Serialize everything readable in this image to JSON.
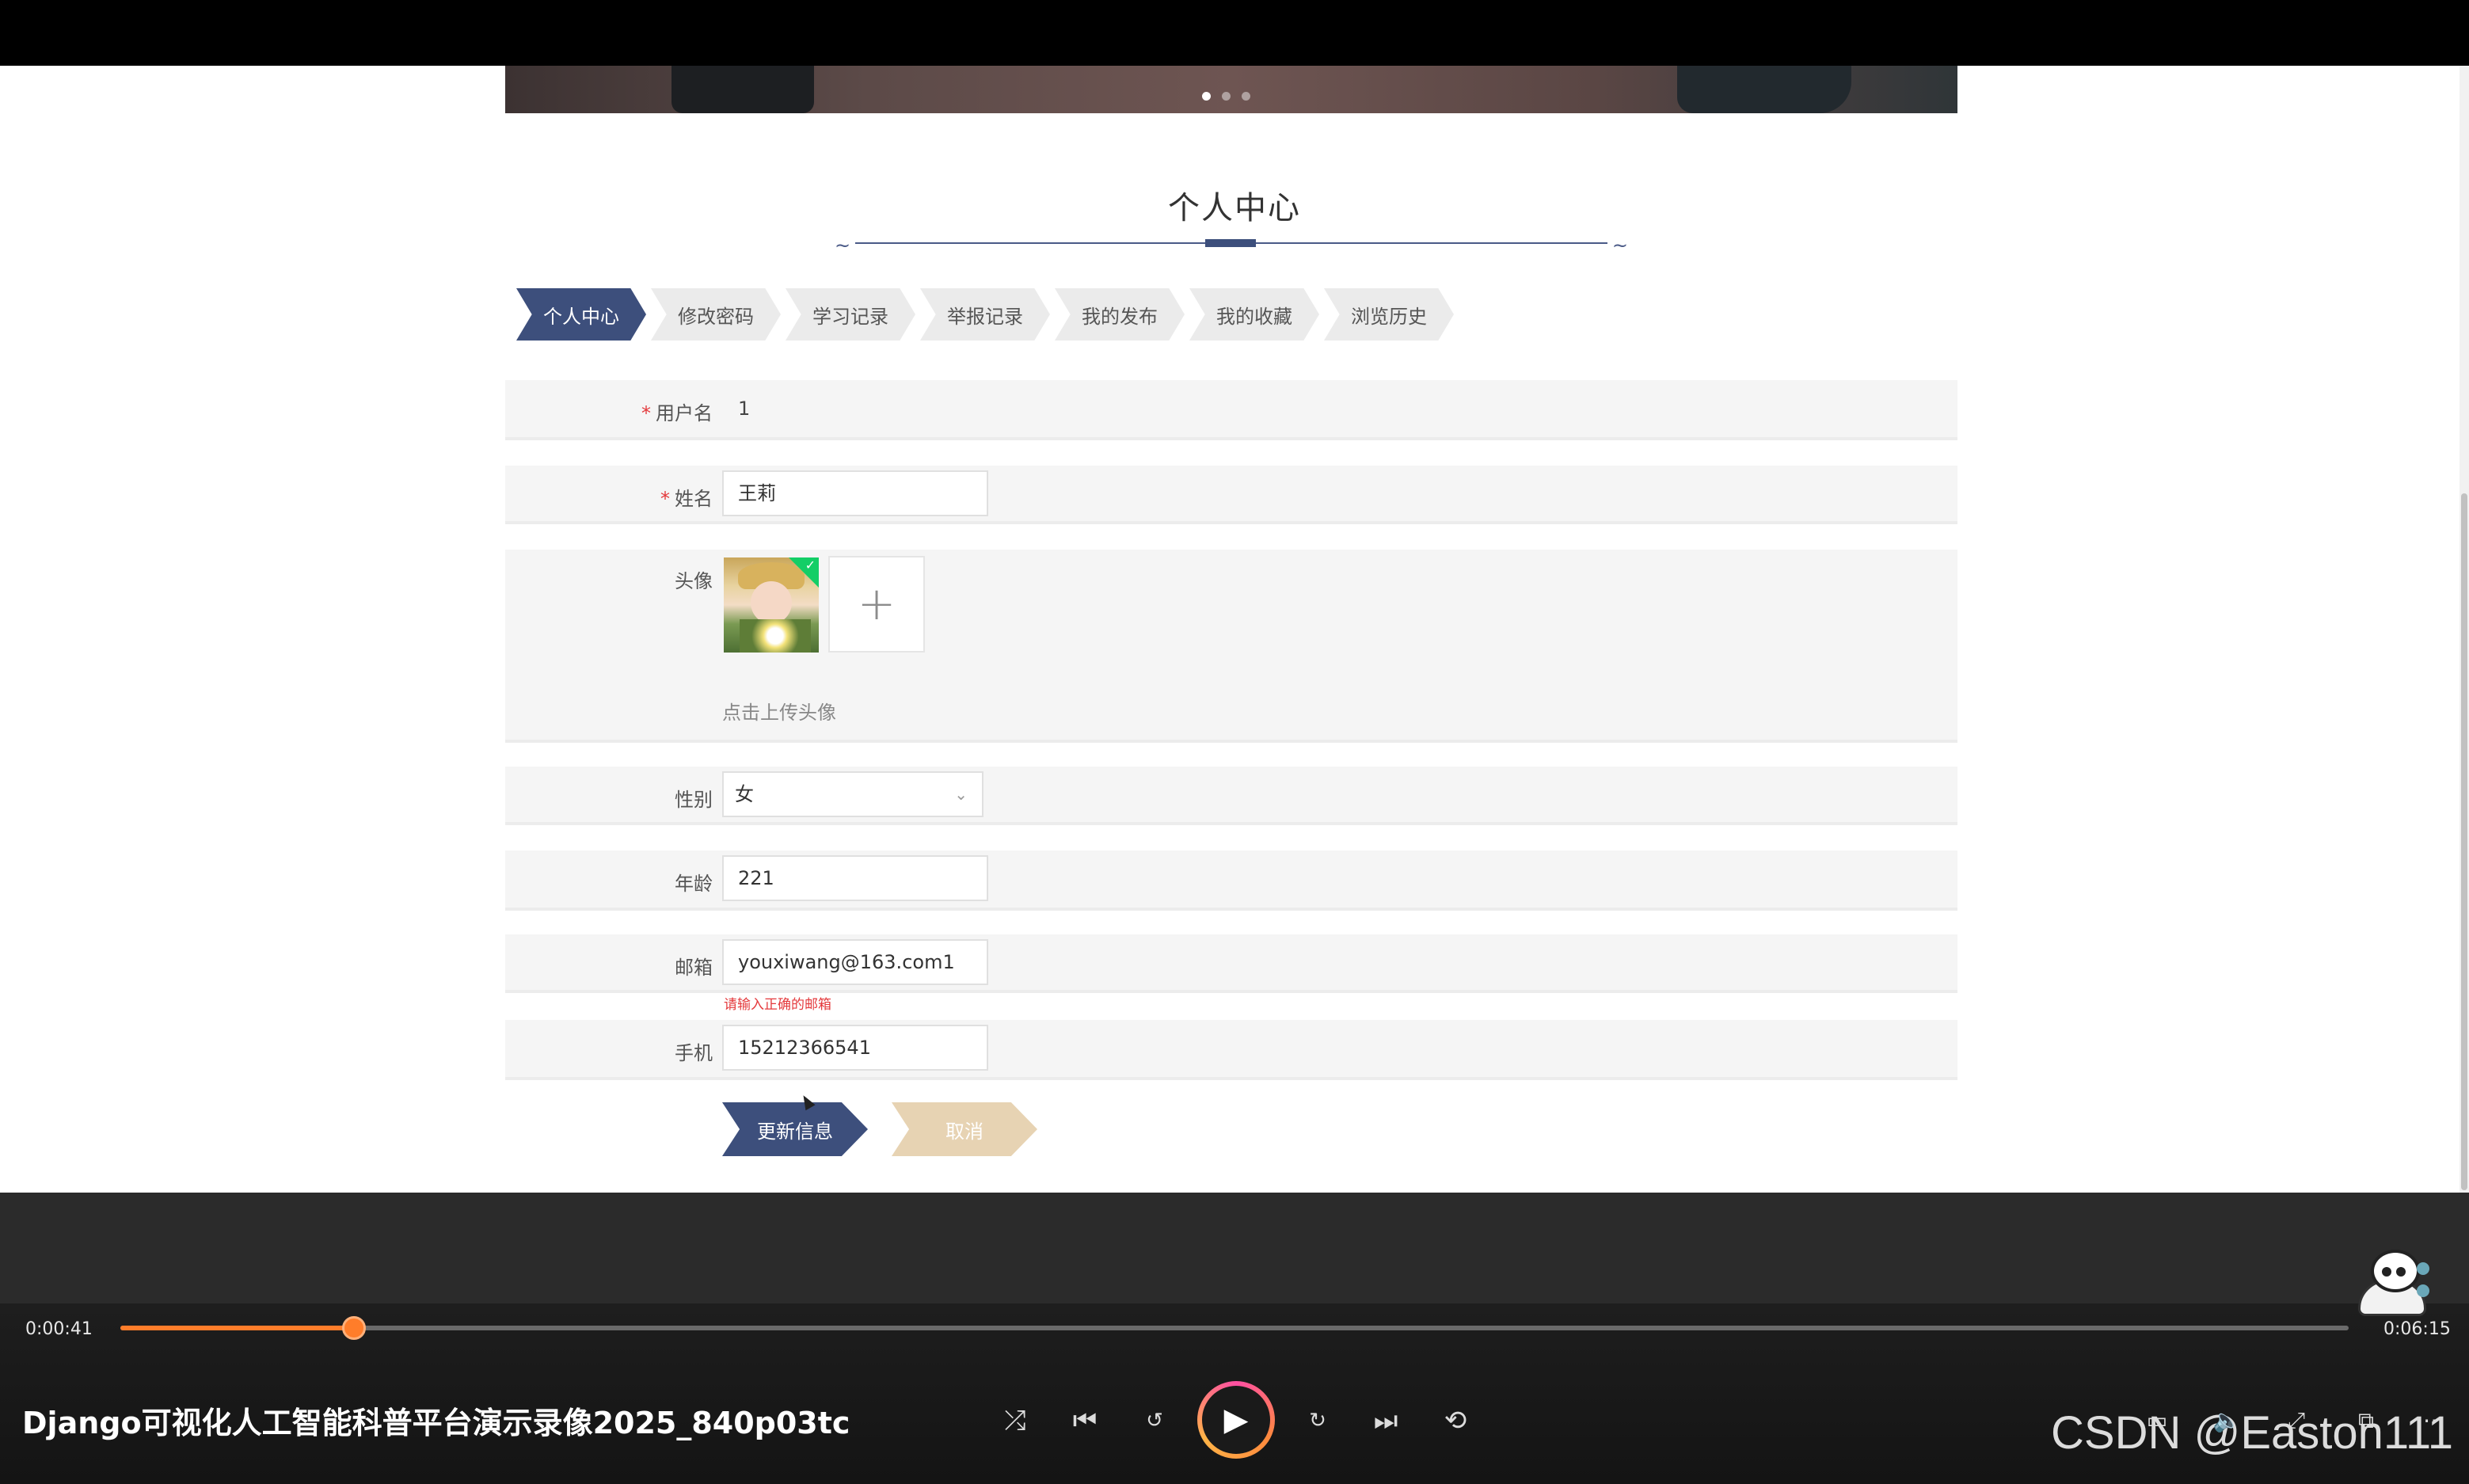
{
  "banner": {
    "dots": 3,
    "active_dot": 0
  },
  "page": {
    "title": "个人中心"
  },
  "tabs": [
    {
      "label": "个人中心",
      "active": true
    },
    {
      "label": "修改密码",
      "active": false
    },
    {
      "label": "学习记录",
      "active": false
    },
    {
      "label": "举报记录",
      "active": false
    },
    {
      "label": "我的发布",
      "active": false
    },
    {
      "label": "我的收藏",
      "active": false
    },
    {
      "label": "浏览历史",
      "active": false
    }
  ],
  "form": {
    "required_mark": "*",
    "username": {
      "label": "用户名",
      "value": "1"
    },
    "name": {
      "label": "姓名",
      "value": "王莉"
    },
    "avatar": {
      "label": "头像",
      "hint": "点击上传头像",
      "add_icon": "+"
    },
    "gender": {
      "label": "性别",
      "value": "女"
    },
    "age": {
      "label": "年龄",
      "value": "221"
    },
    "email": {
      "label": "邮箱",
      "value": "youxiwang@163.com1",
      "error": "请输入正确的邮箱"
    },
    "phone": {
      "label": "手机",
      "value": "15212366541"
    }
  },
  "actions": {
    "update": "更新信息",
    "cancel": "取消"
  },
  "player": {
    "current_time": "0:00:41",
    "total_time": "0:06:15",
    "progress": 0.105,
    "title": "Django可视化人工智能科普平台演示录像2025_840p03tc",
    "controls": [
      "shuffle-icon",
      "previous-icon",
      "rewind-10-icon",
      "play-icon",
      "forward-30-icon",
      "next-icon",
      "repeat-icon",
      "subtitles-icon",
      "volume-icon",
      "expand-icon",
      "mini-player-icon",
      "more-icon"
    ]
  },
  "watermark": "CSDN @Easton111",
  "colors": {
    "accent": "#3d4f7c",
    "cancel": "#e7d3b3",
    "error": "#e4393c",
    "progress": "#ff7d2a"
  }
}
